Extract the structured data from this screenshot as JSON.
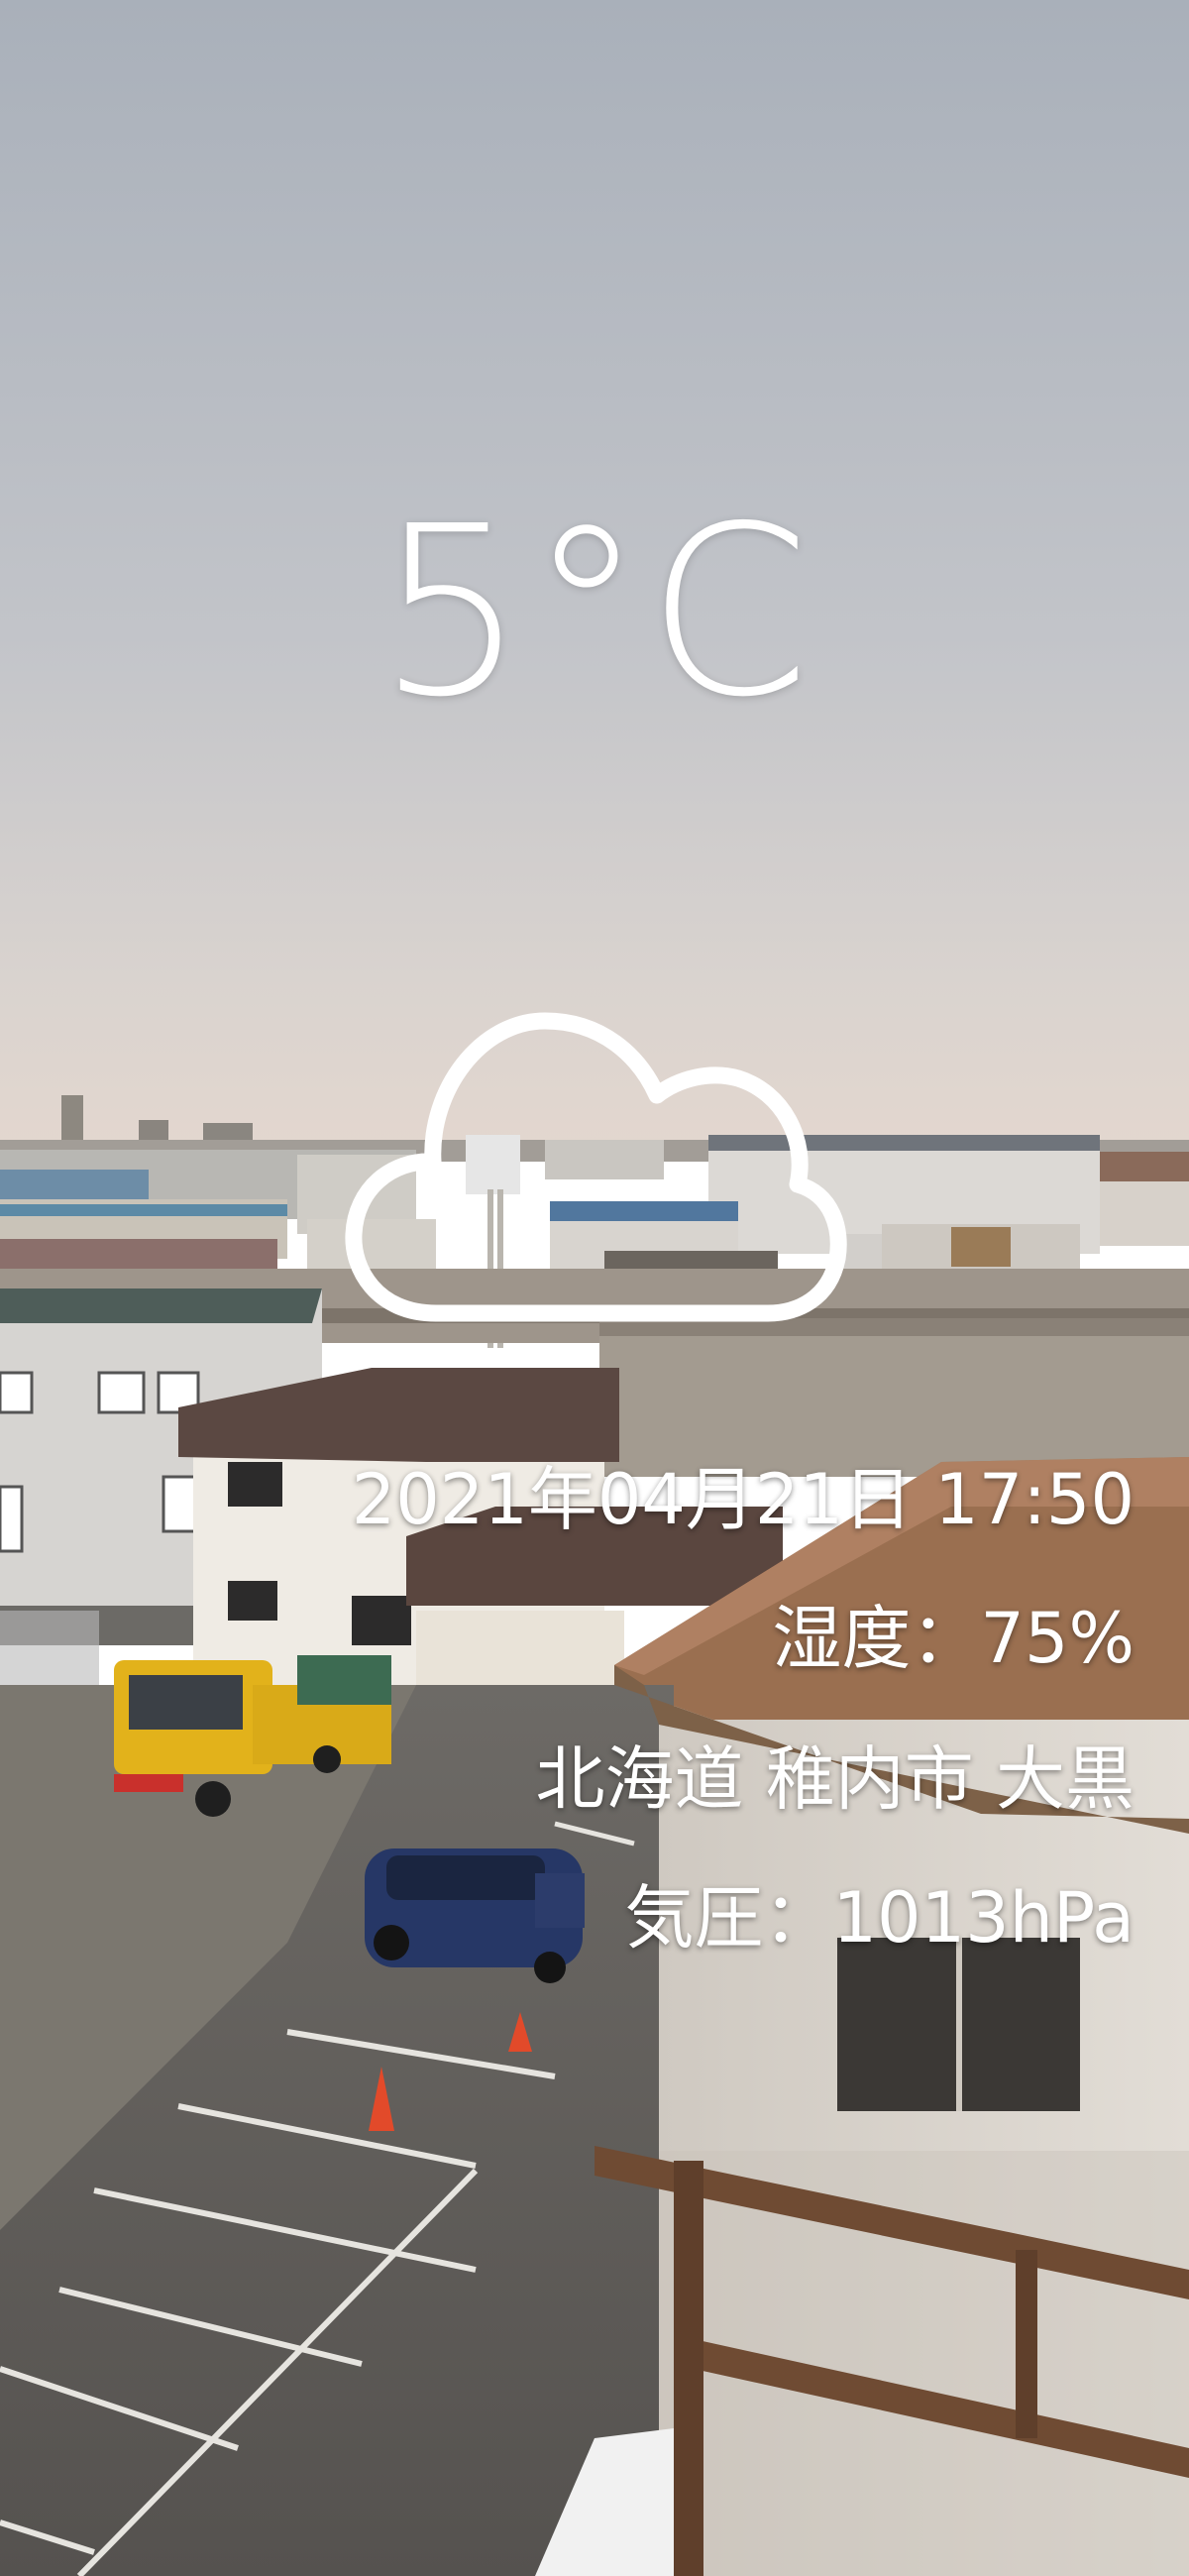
{
  "weather": {
    "temperature": "5°C",
    "condition_icon": "cloud-icon",
    "datetime": "2021年04月21日  17:50",
    "humidity": "湿度：75%",
    "location": "北海道  稚内市  大黒",
    "pressure": "気圧：1013hPa"
  },
  "colors": {
    "sky_top": "#aeb5bf",
    "sky_bottom": "#d6d3d0",
    "text": "#ffffff"
  }
}
